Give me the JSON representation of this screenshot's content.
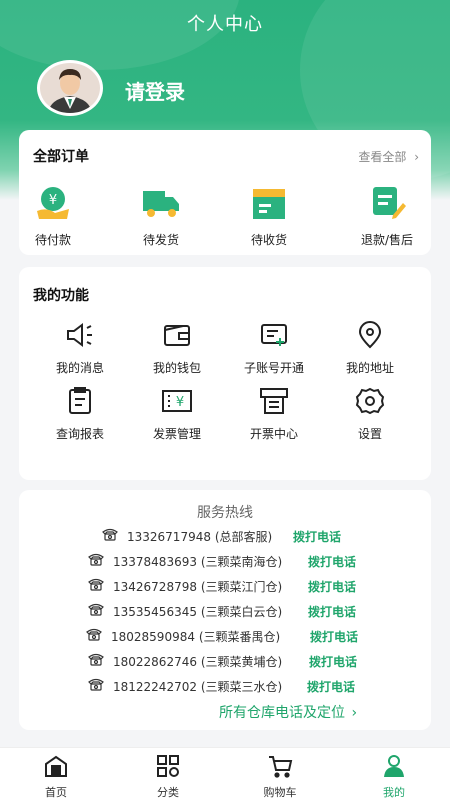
{
  "header": {
    "title": "个人中心",
    "login_text": "请登录"
  },
  "orders": {
    "title": "全部订单",
    "view_all": "查看全部",
    "items": [
      {
        "label": "待付款",
        "icon": "pending-payment-icon"
      },
      {
        "label": "待发货",
        "icon": "truck-icon"
      },
      {
        "label": "待收货",
        "icon": "box-icon"
      },
      {
        "label": "退款/售后",
        "icon": "refund-icon"
      }
    ]
  },
  "functions": {
    "title": "我的功能",
    "items": [
      {
        "label": "我的消息",
        "icon": "megaphone-icon"
      },
      {
        "label": "我的钱包",
        "icon": "wallet-icon"
      },
      {
        "label": "子账号开通",
        "icon": "sub-account-icon"
      },
      {
        "label": "我的地址",
        "icon": "location-icon"
      },
      {
        "label": "查询报表",
        "icon": "report-icon"
      },
      {
        "label": "发票管理",
        "icon": "invoice-icon"
      },
      {
        "label": "开票中心",
        "icon": "printer-icon"
      },
      {
        "label": "设置",
        "icon": "gear-icon"
      }
    ]
  },
  "hotline": {
    "title": "服务热线",
    "call_label": "拨打电话",
    "rows": [
      {
        "number": "13326717948",
        "desc": "(总部客服)"
      },
      {
        "number": "13378483693",
        "desc": "(三颗菜南海仓)"
      },
      {
        "number": "13426728798",
        "desc": "(三颗菜江门仓)"
      },
      {
        "number": "13535456345",
        "desc": "(三颗菜白云仓)"
      },
      {
        "number": "18028590984",
        "desc": "(三颗菜番禺仓)"
      },
      {
        "number": "18022862746",
        "desc": "(三颗菜黄埔仓)"
      },
      {
        "number": "18122242702",
        "desc": "(三颗菜三水仓)"
      }
    ],
    "all_warehouses": "所有仓库电话及定位"
  },
  "tabbar": {
    "items": [
      {
        "label": "首页",
        "icon": "home-icon"
      },
      {
        "label": "分类",
        "icon": "category-icon"
      },
      {
        "label": "购物车",
        "icon": "cart-icon"
      },
      {
        "label": "我的",
        "icon": "user-icon"
      }
    ]
  },
  "colors": {
    "brand": "#2bb27f",
    "accent_text": "#1fa56b"
  }
}
